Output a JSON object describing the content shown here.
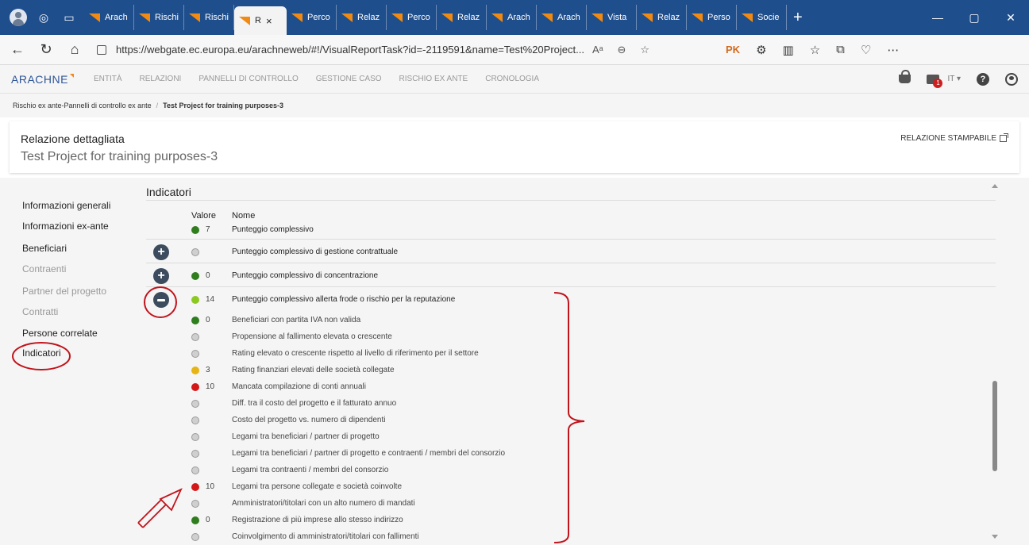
{
  "browser": {
    "tabs": [
      {
        "label": "Arach",
        "active": false
      },
      {
        "label": "Rischi",
        "active": false
      },
      {
        "label": "Rischi",
        "active": false
      },
      {
        "label": "R",
        "active": true
      },
      {
        "label": "Perco",
        "active": false
      },
      {
        "label": "Relaz",
        "active": false
      },
      {
        "label": "Perco",
        "active": false
      },
      {
        "label": "Relaz",
        "active": false
      },
      {
        "label": "Arach",
        "active": false
      },
      {
        "label": "Arach",
        "active": false
      },
      {
        "label": "Vista",
        "active": false
      },
      {
        "label": "Relaz",
        "active": false
      },
      {
        "label": "Perso",
        "active": false
      },
      {
        "label": "Socie",
        "active": false
      }
    ],
    "url": "https://webgate.ec.europa.eu/arachneweb/#!/VisualReportTask?id=-2119591&name=Test%20Project...",
    "profile_badge": "PK",
    "read_aloud": "Aᵃ",
    "tab_close": "×",
    "new_tab": "+",
    "win_minimize": "—",
    "win_restore": "▢",
    "win_close": "✕"
  },
  "app": {
    "logo": "ARACHNE",
    "nav": [
      "ENTITÀ",
      "RELAZIONI",
      "PANNELLI DI CONTROLLO",
      "GESTIONE CASO",
      "RISCHIO EX ANTE",
      "CRONOLOGIA"
    ],
    "notification_count": "1",
    "language": "IT"
  },
  "breadcrumb": {
    "parent": "Rischio ex ante-Pannelli di controllo ex ante",
    "separator": "/",
    "current": "Test Project for training purposes-3"
  },
  "header": {
    "title": "Relazione dettagliata",
    "subtitle": "Test Project for training purposes-3",
    "printable_label": "RELAZIONE STAMPABILE"
  },
  "sidebar": {
    "items": [
      {
        "label": "Informazioni generali",
        "enabled": true
      },
      {
        "label": "Informazioni ex-ante",
        "enabled": true
      },
      {
        "label": "Beneficiari",
        "enabled": true
      },
      {
        "label": "Contraenti",
        "enabled": false
      },
      {
        "label": "Partner del progetto",
        "enabled": false
      },
      {
        "label": "Contratti",
        "enabled": false
      },
      {
        "label": "Persone correlate",
        "enabled": true
      },
      {
        "label": "Indicatori",
        "enabled": true
      }
    ]
  },
  "indicators": {
    "section_title": "Indicatori",
    "col_value": "Valore",
    "col_name": "Nome",
    "rows": [
      {
        "color": "green",
        "value": "7",
        "name": "Punteggio complessivo",
        "toggle": "none"
      },
      {
        "color": "grey",
        "value": "",
        "name": "Punteggio complessivo di gestione contrattuale",
        "toggle": "plus"
      },
      {
        "color": "green",
        "value": "0",
        "name": "Punteggio complessivo di concentrazione",
        "toggle": "plus"
      },
      {
        "color": "lime",
        "value": "14",
        "name": "Punteggio complessivo allerta frode o rischio per la reputazione",
        "toggle": "minus"
      },
      {
        "color": "green",
        "value": "0",
        "name": "Beneficiari con partita IVA non valida",
        "toggle": "child"
      },
      {
        "color": "grey",
        "value": "",
        "name": "Propensione al fallimento elevata o crescente",
        "toggle": "child"
      },
      {
        "color": "grey",
        "value": "",
        "name": "Rating elevato o crescente rispetto al livello di riferimento per il settore",
        "toggle": "child"
      },
      {
        "color": "yellow",
        "value": "3",
        "name": "Rating finanziari elevati delle società collegate",
        "toggle": "child"
      },
      {
        "color": "red",
        "value": "10",
        "name": "Mancata compilazione di conti annuali",
        "toggle": "child"
      },
      {
        "color": "grey",
        "value": "",
        "name": "Diff. tra il costo del progetto e il fatturato annuo",
        "toggle": "child"
      },
      {
        "color": "grey",
        "value": "",
        "name": "Costo del progetto vs. numero di dipendenti",
        "toggle": "child"
      },
      {
        "color": "grey",
        "value": "",
        "name": "Legami tra beneficiari / partner di progetto",
        "toggle": "child"
      },
      {
        "color": "grey",
        "value": "",
        "name": "Legami tra beneficiari / partner di progetto e contraenti / membri del consorzio",
        "toggle": "child"
      },
      {
        "color": "grey",
        "value": "",
        "name": "Legami tra contraenti / membri del consorzio",
        "toggle": "child"
      },
      {
        "color": "red",
        "value": "10",
        "name": "Legami tra persone collegate e società coinvolte",
        "toggle": "child"
      },
      {
        "color": "grey",
        "value": "",
        "name": "Amministratori/titolari con un alto numero di mandati",
        "toggle": "child"
      },
      {
        "color": "green",
        "value": "0",
        "name": "Registrazione di più imprese allo stesso indirizzo",
        "toggle": "child"
      },
      {
        "color": "grey",
        "value": "",
        "name": "Coinvolgimento di amministratori/titolari con fallimenti",
        "toggle": "child"
      }
    ]
  },
  "colors": {
    "tabstrip": "#1f4e8c",
    "favicon": "#f08a12",
    "annotation": "#c0141c",
    "green": "#2f7d1f",
    "lime": "#8cc820",
    "yellow": "#e6b416",
    "red": "#d41818",
    "grey": "#cfcfcf"
  }
}
